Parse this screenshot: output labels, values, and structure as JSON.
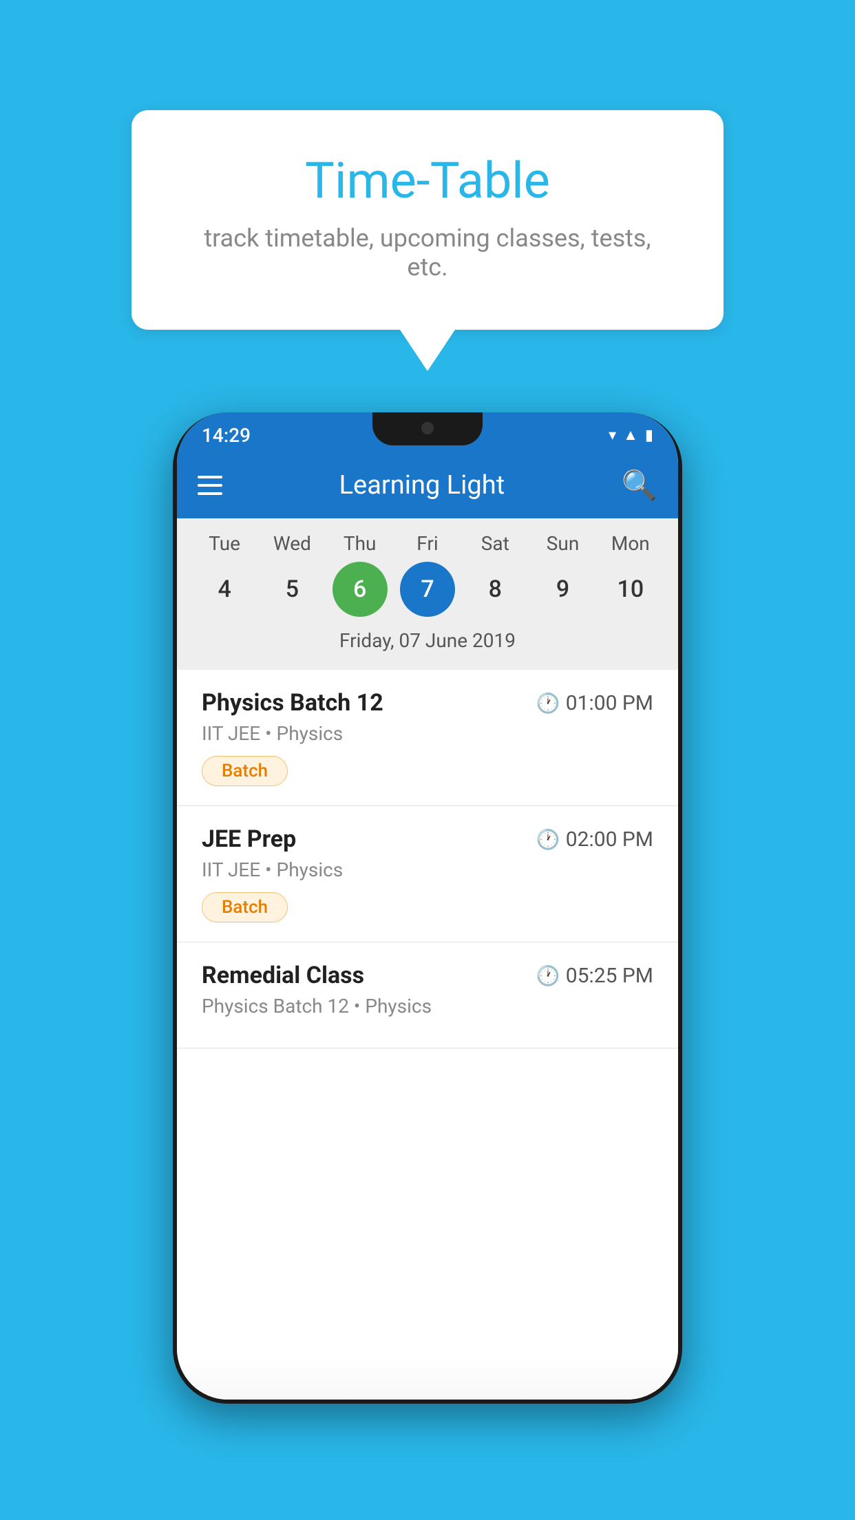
{
  "background_color": "#29b6e8",
  "speech_bubble": {
    "title": "Time-Table",
    "subtitle": "track timetable, upcoming classes, tests, etc."
  },
  "phone": {
    "status_bar": {
      "time": "14:29"
    },
    "app_bar": {
      "title": "Learning Light"
    },
    "calendar": {
      "day_headers": [
        "Tue",
        "Wed",
        "Thu",
        "Fri",
        "Sat",
        "Sun",
        "Mon"
      ],
      "day_numbers": [
        {
          "number": "4",
          "state": "normal"
        },
        {
          "number": "5",
          "state": "normal"
        },
        {
          "number": "6",
          "state": "today"
        },
        {
          "number": "7",
          "state": "selected"
        },
        {
          "number": "8",
          "state": "normal"
        },
        {
          "number": "9",
          "state": "normal"
        },
        {
          "number": "10",
          "state": "normal"
        }
      ],
      "selected_date_label": "Friday, 07 June 2019"
    },
    "schedule": [
      {
        "title": "Physics Batch 12",
        "time": "01:00 PM",
        "subtitle": "IIT JEE • Physics",
        "badge": "Batch"
      },
      {
        "title": "JEE Prep",
        "time": "02:00 PM",
        "subtitle": "IIT JEE • Physics",
        "badge": "Batch"
      },
      {
        "title": "Remedial Class",
        "time": "05:25 PM",
        "subtitle": "Physics Batch 12 • Physics",
        "badge": null
      }
    ]
  }
}
